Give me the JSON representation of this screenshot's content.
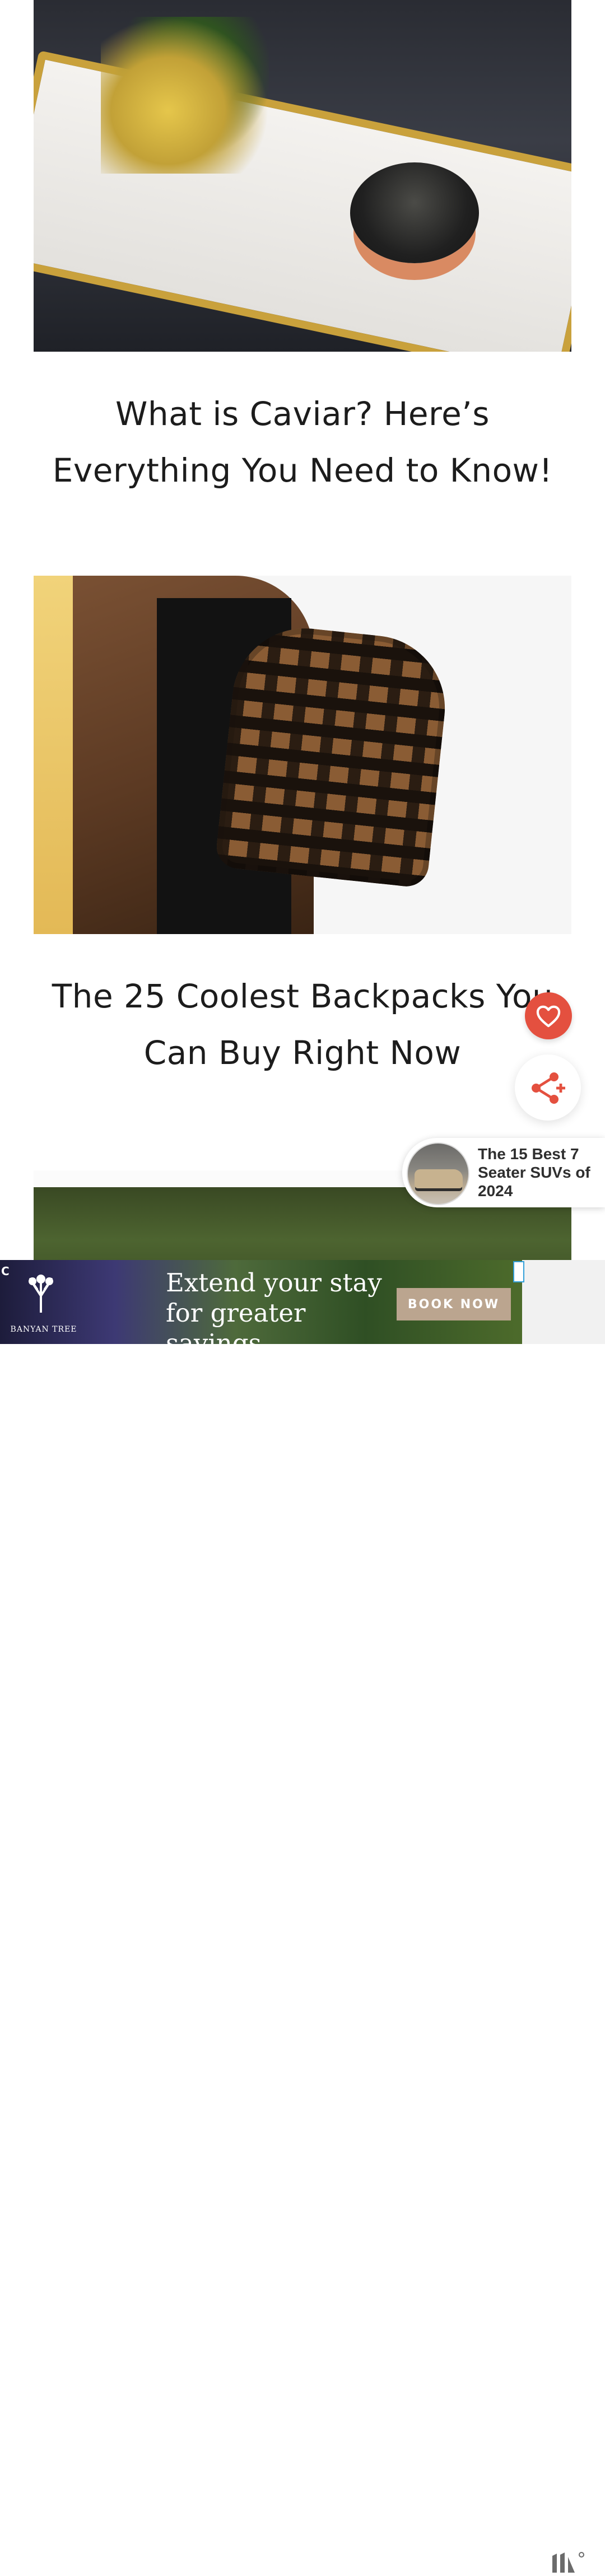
{
  "articles": [
    {
      "title": "What is Caviar? Here’s Everything You Need to Know!"
    },
    {
      "title": "The 25 Coolest Backpacks You Can Buy Right Now"
    }
  ],
  "floating_actions": {
    "heart_icon": "heart-icon",
    "share_icon": "share-icon",
    "accent_color": "#e4503f"
  },
  "recommendation": {
    "title": "The 15 Best 7 Seater SUVs of 2024"
  },
  "ad": {
    "brand": "BANYAN TREE",
    "headline_line1": "Extend your stay",
    "headline_line2": "for greater savings",
    "cta": "BOOK NOW",
    "choice_mark": "C"
  }
}
